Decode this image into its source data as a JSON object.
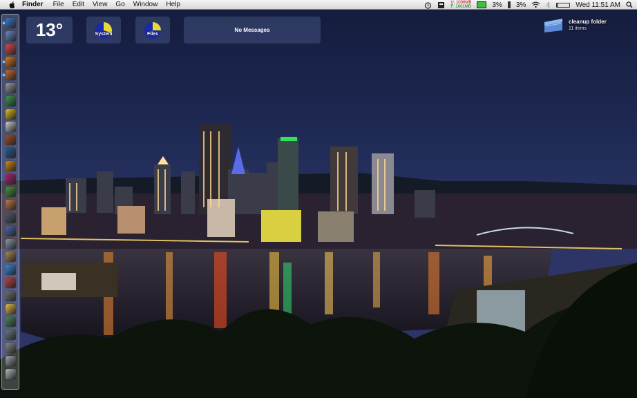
{
  "menubar": {
    "app_name": "Finder",
    "menus": [
      "File",
      "Edit",
      "View",
      "Go",
      "Window",
      "Help"
    ],
    "memory_used": "U: 1036MB",
    "memory_free": "F: 1001MB",
    "cpu_percent": "3%",
    "battery_percent": "3%",
    "battery_level": 0.03,
    "clock": "Wed 11:51 AM",
    "icons": [
      "apple-icon",
      "alarm-icon",
      "monitor-icon",
      "memory-gauge-icon",
      "cpu-gauge-icon",
      "battery-icon",
      "wifi-icon",
      "bluetooth-icon",
      "volume-icon",
      "spotlight-icon"
    ]
  },
  "widgets": {
    "weather_temp": "13°",
    "system_label": "System",
    "files_label": "Files",
    "messages_text": "No Messages",
    "system_usage": 0.3,
    "files_usage": 0.25,
    "pie_colors": {
      "used": "#e8d832",
      "free": "#1a2aa8"
    }
  },
  "desktop_folder": {
    "name": "cleanup folder",
    "count": "11 items"
  },
  "dock": {
    "icons": [
      {
        "name": "finder-icon",
        "color": "#3a7bd5"
      },
      {
        "name": "mail-icon",
        "color": "#6a8ccf"
      },
      {
        "name": "calendar-icon",
        "color": "#e04848"
      },
      {
        "name": "firefox-icon",
        "color": "#e07a20"
      },
      {
        "name": "photos-icon",
        "color": "#c86a30"
      },
      {
        "name": "quill-icon",
        "color": "#9aa0a8"
      },
      {
        "name": "chart-icon",
        "color": "#3a9a50"
      },
      {
        "name": "stickies-icon",
        "color": "#e8c020"
      },
      {
        "name": "pdf-icon",
        "color": "#d0d0d0"
      },
      {
        "name": "bridge-icon",
        "color": "#a85020"
      },
      {
        "name": "photoshop-icon",
        "color": "#2a5a9a"
      },
      {
        "name": "illustrator-icon",
        "color": "#d88a10"
      },
      {
        "name": "indesign-icon",
        "color": "#b02070"
      },
      {
        "name": "leaf-icon",
        "color": "#4a9a3a"
      },
      {
        "name": "books-icon",
        "color": "#c87848"
      },
      {
        "name": "person-icon",
        "color": "#505a6a"
      },
      {
        "name": "globe-icon",
        "color": "#4a6ab0"
      },
      {
        "name": "skate-icon",
        "color": "#8a9aa8"
      },
      {
        "name": "tool-icon",
        "color": "#b08850"
      },
      {
        "name": "itunes-icon",
        "color": "#3a8ad8"
      },
      {
        "name": "camera-icon",
        "color": "#c04040"
      },
      {
        "name": "star-icon",
        "color": "#707070"
      },
      {
        "name": "folder-yellow-icon",
        "color": "#e8c040"
      },
      {
        "name": "window-icon",
        "color": "#4a8a5a"
      },
      {
        "name": "clock-icon",
        "color": "#6a7a88"
      },
      {
        "name": "settings-icon",
        "color": "#8a8a8a"
      },
      {
        "name": "drive-icon",
        "color": "#a0a8b0"
      },
      {
        "name": "trash-icon",
        "color": "#b8bcc0"
      }
    ]
  }
}
